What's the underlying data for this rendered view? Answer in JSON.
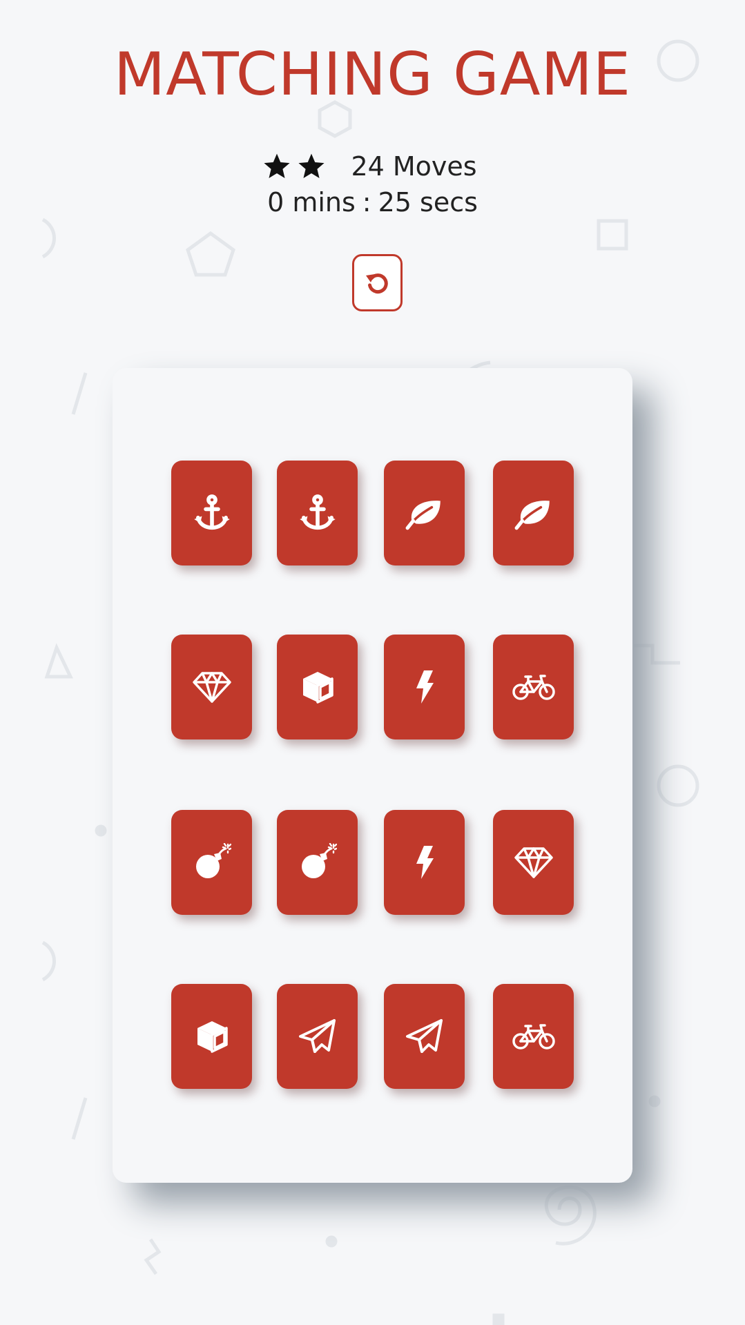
{
  "title": "MATCHING GAME",
  "score_panel": {
    "stars_filled": 2,
    "moves_count": "24",
    "moves_label": "Moves",
    "timer_minutes": "0 mins",
    "timer_separator": ":",
    "timer_seconds": "25 secs",
    "restart_icon": "restart-icon"
  },
  "colors": {
    "accent": "#c0392b",
    "background": "#f6f7f9",
    "board_shadow": "#97a0a9",
    "card_icon": "#ffffff"
  },
  "deck": [
    [
      "anchor",
      "anchor",
      "leaf",
      "leaf"
    ],
    [
      "diamond",
      "cube",
      "bolt",
      "bicycle"
    ],
    [
      "bomb",
      "bomb",
      "bolt",
      "diamond"
    ],
    [
      "cube",
      "paper-plane",
      "paper-plane",
      "bicycle"
    ]
  ]
}
